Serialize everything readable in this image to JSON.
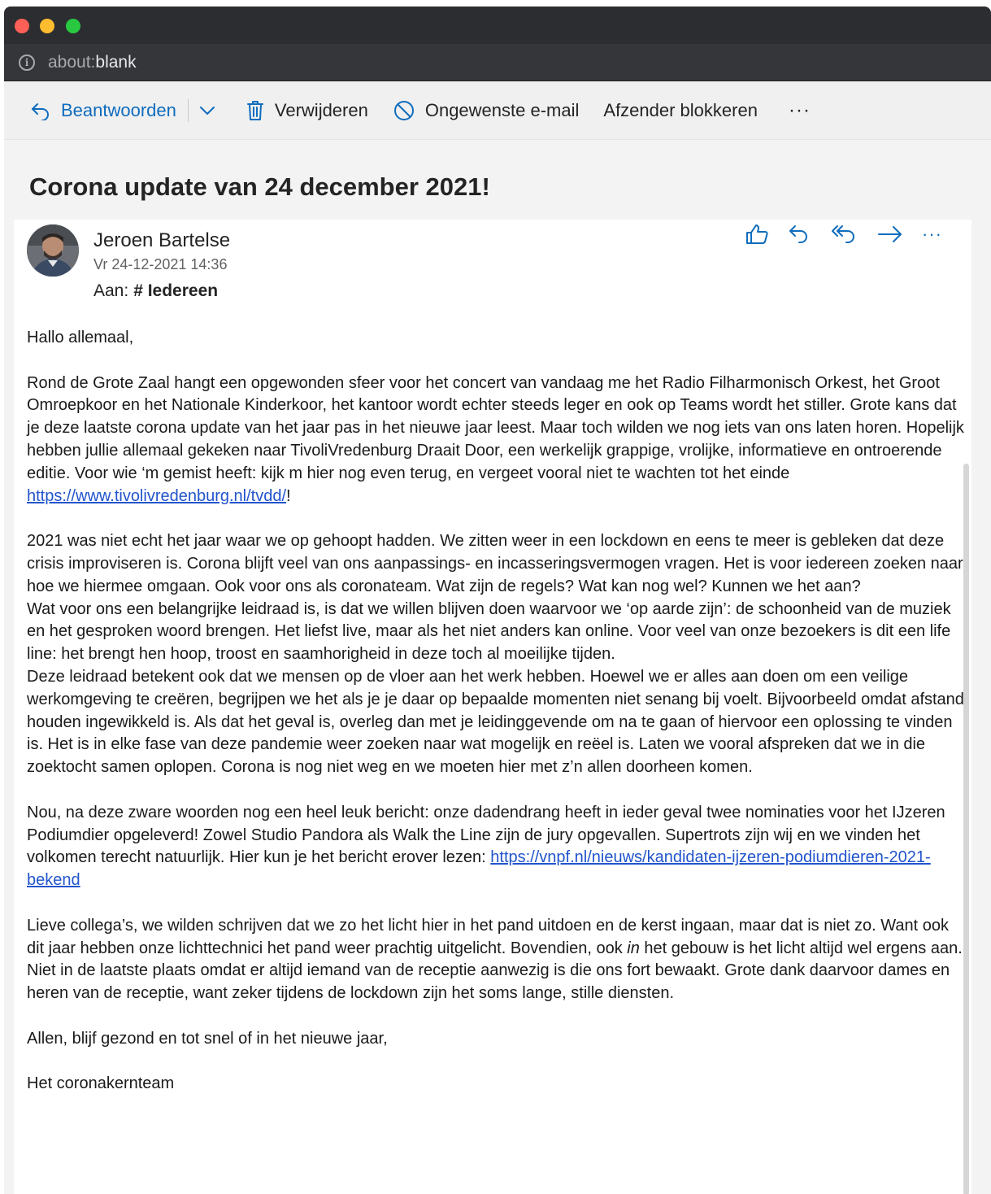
{
  "browser": {
    "url_scheme": "about:",
    "url_path": "blank"
  },
  "toolbar": {
    "reply_label": "Beantwoorden",
    "delete_label": "Verwijderen",
    "junk_label": "Ongewenste e-mail",
    "block_label": "Afzender blokkeren",
    "more_label": "···"
  },
  "email": {
    "subject": "Corona update van 24 december 2021!",
    "sender_name": "Jeroen Bartelse",
    "date": "Vr 24-12-2021 14:36",
    "to_label": "Aan:",
    "to_value": "# Iedereen",
    "more_actions_label": "···",
    "greeting": "Hallo allemaal,",
    "p1_text": "Rond de Grote Zaal hangt een opgewonden sfeer voor het concert van vandaag me het Radio Filharmonisch Orkest, het Groot Omroepkoor en het Nationale Kinderkoor, het kantoor wordt echter steeds leger en ook op Teams wordt het stiller. Grote kans dat je deze laatste corona update van het jaar pas in het nieuwe jaar leest. Maar toch wilden we nog iets van ons laten horen. Hopelijk hebben jullie allemaal gekeken naar TivoliVredenburg Draait Door, een werkelijk grappige, vrolijke, informatieve en ontroerende editie. Voor wie ‘m gemist heeft: kijk m hier nog even terug, en vergeet vooral niet te wachten tot het einde ",
    "p1_link": "https://www.tivolivredenburg.nl/tvdd/",
    "p1_end": "!",
    "p2a": "2021 was niet echt het jaar waar we op gehoopt hadden. We zitten weer in een lockdown en eens te meer is gebleken dat deze crisis improviseren is. Corona blijft veel van ons aanpassings- en incasseringsvermogen vragen. Het is voor iedereen zoeken naar hoe we hiermee omgaan. Ook voor ons als coronateam. Wat zijn de regels? Wat kan nog wel? Kunnen we het aan?",
    "p2b": "Wat voor ons een belangrijke leidraad is, is dat we willen blijven doen waarvoor we ‘op aarde zijn’: de schoonheid van de muziek en het gesproken woord brengen. Het liefst live, maar als het niet anders kan online. Voor veel van onze bezoekers is dit een life line: het brengt hen hoop, troost en saamhorigheid in deze toch al moeilijke tijden.",
    "p2c": "Deze leidraad betekent ook dat we mensen op de vloer aan het werk hebben. Hoewel we er alles aan doen om een veilige werkomgeving te creëren, begrijpen we het als je je daar op bepaalde momenten niet senang bij voelt. Bijvoorbeeld omdat afstand houden ingewikkeld is. Als dat het geval is, overleg dan met je leidinggevende om na te gaan of hiervoor een oplossing te vinden is. Het is in elke fase van deze pandemie weer zoeken naar wat mogelijk en reëel is. Laten we vooral afspreken dat we in die zoektocht samen oplopen. Corona is nog niet weg en we moeten hier met z’n allen doorheen komen.",
    "p3_text": "Nou, na deze zware woorden nog een heel leuk bericht: onze dadendrang heeft in ieder geval twee nominaties voor het IJzeren Podiumdier opgeleverd! Zowel Studio Pandora als Walk the Line zijn de jury opgevallen. Supertrots zijn wij en we vinden het volkomen terecht natuurlijk. Hier kun je het bericht erover lezen: ",
    "p3_link": "https://vnpf.nl/nieuws/kandidaten-ijzeren-podiumdieren-2021-bekend",
    "p4_a": "Lieve collega’s, we wilden schrijven dat we zo het licht hier in het pand uitdoen en de kerst ingaan, maar dat is niet zo. Want ook dit jaar hebben onze lichttechnici het pand weer prachtig uitgelicht. Bovendien, ook ",
    "p4_em": "in",
    "p4_b": " het gebouw is het licht altijd wel ergens aan. Niet in de laatste plaats omdat er altijd iemand van de receptie aanwezig is die ons fort bewaakt. Grote dank daarvoor dames en heren van de receptie, want zeker tijdens de lockdown zijn het soms lange, stille diensten.",
    "closing": "Allen, blijf gezond en tot snel of in het nieuwe jaar,",
    "signature": "Het coronakernteam"
  },
  "colors": {
    "titlebar": "#2c2d31",
    "addressbar": "#35363a",
    "accent_blue": "#0f6cbd",
    "link_blue": "#2255cc"
  },
  "icons": [
    "info-icon",
    "reply-icon",
    "chevron-down-icon",
    "trash-icon",
    "blocked-icon",
    "thumbs-up-icon",
    "reply-all-icon",
    "forward-icon",
    "more-icon"
  ]
}
